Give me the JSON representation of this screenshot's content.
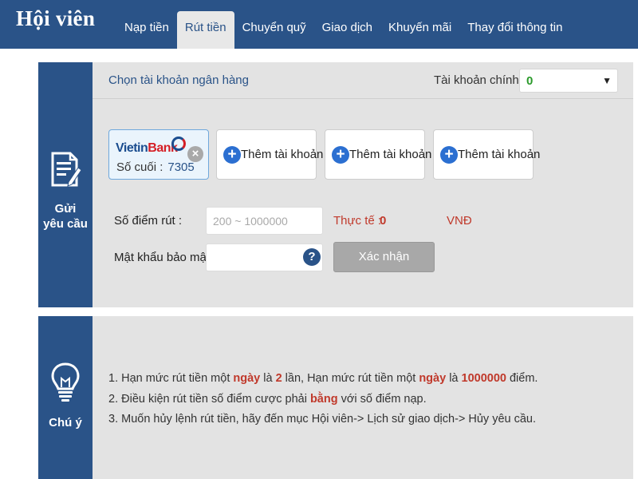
{
  "header": {
    "brand": "Hội viên",
    "nav": [
      {
        "label": "Nạp tiền",
        "active": false
      },
      {
        "label": "Rút tiền",
        "active": true
      },
      {
        "label": "Chuyển quỹ",
        "active": false
      },
      {
        "label": "Giao dịch",
        "active": false
      },
      {
        "label": "Khuyến mãi",
        "active": false
      },
      {
        "label": "Thay đổi thông tin",
        "active": false
      }
    ]
  },
  "request_panel": {
    "side_label_line1": "Gửi",
    "side_label_line2": "yêu cầu",
    "side_icon": "document-edit-icon",
    "title": "Chọn tài khoản ngân hàng",
    "main_account_label": "Tài khoản chính :",
    "main_account_value": "0",
    "bank_card": {
      "bank_name_part1": "Vietin",
      "bank_name_part2": "Bank",
      "last_digits_label": "Số cuối :",
      "last_digits": "7305",
      "remove_icon": "close-icon"
    },
    "add_account_label": "Thêm tài khoản",
    "amount_label": "Số điểm rút :",
    "amount_placeholder": "200 ~ 1000000",
    "password_label": "Mật khẩu bảo mật :",
    "actual_label": "Thực tế :",
    "actual_value": "0",
    "currency": "VNĐ",
    "confirm_label": "Xác nhận"
  },
  "notes_panel": {
    "side_label": "Chú ý",
    "side_icon": "lightbulb-icon",
    "note1": {
      "a": "1. Hạn mức rút tiền một ",
      "b": "ngày",
      "c": " là ",
      "d": "2",
      "e": " lần, Hạn mức rút tiền một ",
      "f": "ngày",
      "g": " là ",
      "h": "1000000",
      "i": " điểm."
    },
    "note2": {
      "a": "2. Điều kiện rút tiền số điểm cược phải ",
      "b": "bằng",
      "c": " với số điểm nạp."
    },
    "note3": "3. Muốn hủy lệnh rút tiền, hãy đến mục Hội viên-> Lịch sử giao dịch-> Hủy yêu cầu.",
    "colors": {
      "highlight": "#c0392b",
      "brand": "#2a5388"
    }
  }
}
